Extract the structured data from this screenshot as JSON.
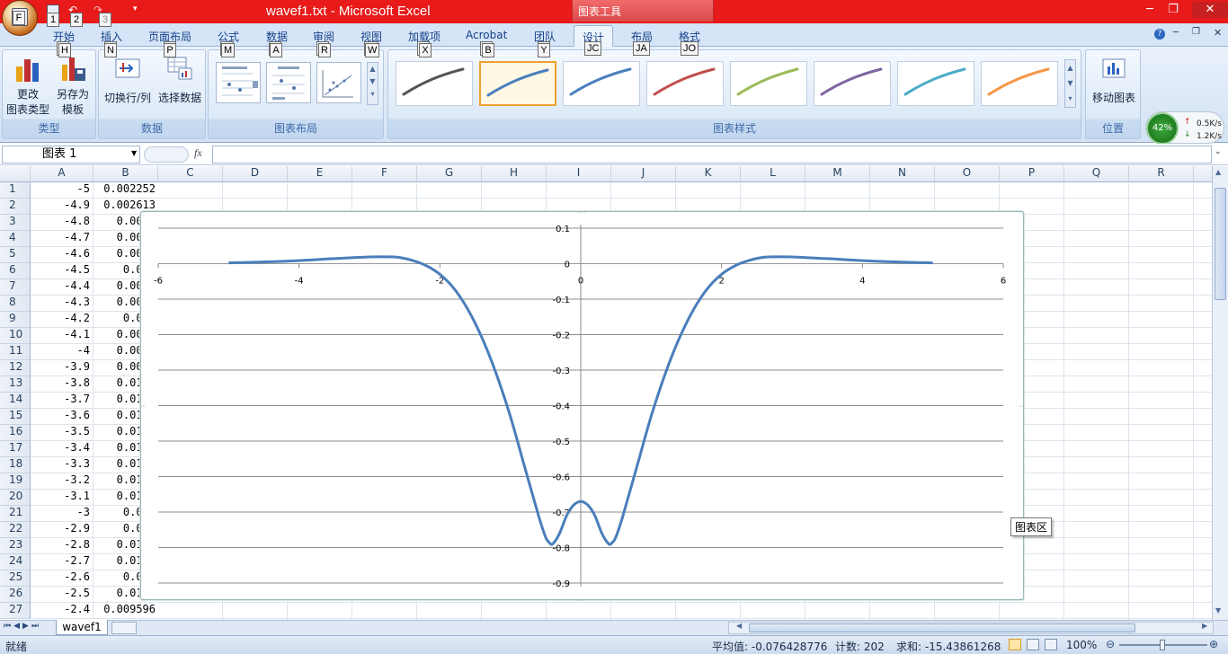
{
  "window": {
    "title": "wavef1.txt - Microsoft Excel",
    "context_tab_title": "图表工具",
    "qat_keytips": [
      "1",
      "2",
      "3"
    ],
    "office_keytip": "F"
  },
  "ribbon": {
    "tabs": [
      {
        "label": "开始",
        "keytip": "H"
      },
      {
        "label": "插入",
        "keytip": "N"
      },
      {
        "label": "页面布局",
        "keytip": "P"
      },
      {
        "label": "公式",
        "keytip": "M"
      },
      {
        "label": "数据",
        "keytip": "A"
      },
      {
        "label": "审阅",
        "keytip": "R"
      },
      {
        "label": "视图",
        "keytip": "W"
      },
      {
        "label": "加载项",
        "keytip": "X"
      },
      {
        "label": "Acrobat",
        "keytip": "B"
      },
      {
        "label": "团队",
        "keytip": "Y"
      },
      {
        "label": "设计",
        "keytip": "JC"
      },
      {
        "label": "布局",
        "keytip": "JA"
      },
      {
        "label": "格式",
        "keytip": "JO"
      }
    ],
    "groups": {
      "type": {
        "label": "类型",
        "change_line1": "更改",
        "change_line2": "图表类型",
        "save_line1": "另存为",
        "save_line2": "模板"
      },
      "data": {
        "label": "数据",
        "switch": "切换行/列",
        "select": "选择数据"
      },
      "layout": {
        "label": "图表布局"
      },
      "styles": {
        "label": "图表样式",
        "colors": [
          "#555555",
          "#4a7fbd",
          "#4a7fbd",
          "#c0504d",
          "#9bbb59",
          "#8064a2",
          "#4bacc6",
          "#f79646"
        ],
        "selected_index": 1
      },
      "location": {
        "label": "位置",
        "move": "移动图表"
      }
    }
  },
  "netmon": {
    "percent": "42%",
    "up": "0.5K/s",
    "down": "1.2K/s"
  },
  "formula_bar": {
    "name_box": "图表 1",
    "fx": "fx"
  },
  "grid": {
    "columns": [
      "A",
      "B",
      "C",
      "D",
      "E",
      "F",
      "G",
      "H",
      "I",
      "J",
      "K",
      "L",
      "M",
      "N",
      "O",
      "P",
      "Q",
      "R"
    ],
    "rows": [
      {
        "n": "1",
        "a": "-5",
        "b": "0.002252"
      },
      {
        "n": "2",
        "a": "-4.9",
        "b": "0.002613"
      },
      {
        "n": "3",
        "a": "-4.8",
        "b": "0.0030"
      },
      {
        "n": "4",
        "a": "-4.7",
        "b": "0.0034"
      },
      {
        "n": "5",
        "a": "-4.6",
        "b": "0.0040"
      },
      {
        "n": "6",
        "a": "-4.5",
        "b": "0.004"
      },
      {
        "n": "7",
        "a": "-4.4",
        "b": "0.0052"
      },
      {
        "n": "8",
        "a": "-4.3",
        "b": "0.0059"
      },
      {
        "n": "9",
        "a": "-4.2",
        "b": "0.006"
      },
      {
        "n": "10",
        "a": "-4.1",
        "b": "0.0076"
      },
      {
        "n": "11",
        "a": "-4",
        "b": "0.0085"
      },
      {
        "n": "12",
        "a": "-3.9",
        "b": "0.0096"
      },
      {
        "n": "13",
        "a": "-3.8",
        "b": "0.0107"
      },
      {
        "n": "14",
        "a": "-3.7",
        "b": "0.0118"
      },
      {
        "n": "15",
        "a": "-3.6",
        "b": "0.0130"
      },
      {
        "n": "16",
        "a": "-3.5",
        "b": "0.0143"
      },
      {
        "n": "17",
        "a": "-3.4",
        "b": "0.0155"
      },
      {
        "n": "18",
        "a": "-3.3",
        "b": "0.0167"
      },
      {
        "n": "19",
        "a": "-3.2",
        "b": "0.0177"
      },
      {
        "n": "20",
        "a": "-3.1",
        "b": "0.0188"
      },
      {
        "n": "21",
        "a": "-3",
        "b": "0.019"
      },
      {
        "n": "22",
        "a": "-2.9",
        "b": "0.019"
      },
      {
        "n": "23",
        "a": "-2.8",
        "b": "0.0192"
      },
      {
        "n": "24",
        "a": "-2.7",
        "b": "0.0182"
      },
      {
        "n": "25",
        "a": "-2.6",
        "b": "0.018"
      },
      {
        "n": "26",
        "a": "-2.5",
        "b": "0.0135"
      },
      {
        "n": "27",
        "a": "-2.4",
        "b": "0.009596"
      }
    ]
  },
  "chart_data": {
    "type": "scatter",
    "title": "",
    "xlabel": "",
    "ylabel": "",
    "xlim": [
      -6,
      6
    ],
    "ylim": [
      -0.9,
      0.1
    ],
    "x_ticks": [
      "-6",
      "-4",
      "-2",
      "0",
      "2",
      "4",
      "6"
    ],
    "y_ticks": [
      "0.1",
      "0",
      "-0.1",
      "-0.2",
      "-0.3",
      "-0.4",
      "-0.5",
      "-0.6",
      "-0.7",
      "-0.8",
      "-0.9"
    ],
    "grid": true,
    "legend": "none",
    "line_color": "#4a7ebb",
    "series": [
      {
        "x": [
          -5,
          -4.5,
          -4,
          -3.5,
          -3,
          -2.8,
          -2.6,
          -2.4,
          -2.2,
          -2,
          -1.8,
          -1.6,
          -1.4,
          -1.2,
          -1,
          -0.8,
          -0.6,
          -0.5,
          -0.45,
          -0.4,
          -0.3,
          -0.2,
          -0.1,
          0,
          0.1,
          0.2,
          0.3,
          0.4,
          0.45,
          0.5,
          0.6,
          0.8,
          1,
          1.2,
          1.4,
          1.6,
          1.8,
          2,
          2.2,
          2.4,
          2.6,
          2.8,
          3,
          3.5,
          4,
          4.5,
          5
        ],
        "y": [
          0.0023,
          0.0048,
          0.0085,
          0.0143,
          0.019,
          0.0192,
          0.018,
          0.0096,
          -0.005,
          -0.03,
          -0.07,
          -0.13,
          -0.21,
          -0.31,
          -0.43,
          -0.57,
          -0.71,
          -0.77,
          -0.785,
          -0.79,
          -0.76,
          -0.71,
          -0.68,
          -0.67,
          -0.68,
          -0.71,
          -0.76,
          -0.79,
          -0.785,
          -0.77,
          -0.71,
          -0.57,
          -0.43,
          -0.31,
          -0.21,
          -0.13,
          -0.07,
          -0.03,
          -0.005,
          0.0096,
          0.018,
          0.0192,
          0.019,
          0.0143,
          0.0085,
          0.0048,
          0.0023
        ]
      }
    ]
  },
  "chart_tooltip": "图表区",
  "sheet_tab": "wavef1",
  "status": {
    "ready": "就绪",
    "average": "平均值: -0.076428776",
    "count": "计数: 202",
    "sum": "求和: -15.43861268",
    "zoom": "100%"
  }
}
